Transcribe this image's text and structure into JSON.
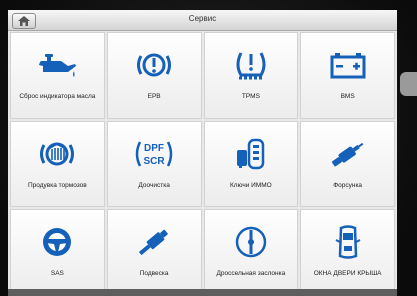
{
  "header": {
    "title": "Сервис"
  },
  "tiles": [
    {
      "label": "Сброс индикатора масла"
    },
    {
      "label": "EPB"
    },
    {
      "label": "TPMS"
    },
    {
      "label": "BMS"
    },
    {
      "label": "Продувка тормозов"
    },
    {
      "label": "Доочистка"
    },
    {
      "label": "Ключи ИММО"
    },
    {
      "label": "Форсунка"
    },
    {
      "label": "SAS"
    },
    {
      "label": "Подвеска"
    },
    {
      "label": "Дроссельная заслонка"
    },
    {
      "label": "ОКНА ДВЕРИ КРЫША"
    }
  ],
  "icons": {
    "oil": "oil-can-icon",
    "epb": "parking-brake-icon",
    "tpms": "tire-pressure-icon",
    "bms": "battery-icon",
    "bleed": "brake-bleed-icon",
    "dpf": "dpf-scr-icon",
    "immo": "immo-key-icon",
    "injector": "injector-icon",
    "sas": "steering-wheel-icon",
    "suspension": "suspension-icon",
    "throttle": "throttle-icon",
    "window": "window-door-roof-icon"
  },
  "dpf_icon_text": {
    "top": "DPF",
    "bottom": "SCR"
  },
  "colors": {
    "icon": "#1560b8",
    "tile": "#f7f7f7"
  }
}
